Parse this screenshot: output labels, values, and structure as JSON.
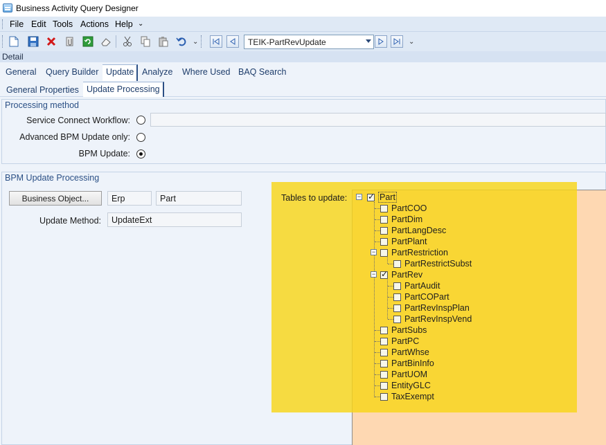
{
  "window": {
    "title": "Business Activity Query Designer"
  },
  "menu": [
    "File",
    "Edit",
    "Tools",
    "Actions",
    "Help"
  ],
  "toolbar": {
    "icons": [
      "new-icon",
      "save-icon",
      "delete-icon",
      "attach-icon",
      "refresh-icon",
      "clear-icon",
      "cut-icon",
      "copy-icon",
      "paste-icon",
      "undo-icon"
    ],
    "record_value": "TEIK-PartRevUpdate"
  },
  "detail": {
    "label": "Detail"
  },
  "tabs": [
    "General",
    "Query Builder",
    "Update",
    "Analyze",
    "Where Used",
    "BAQ Search"
  ],
  "subtabs": [
    "General Properties",
    "Update  Processing"
  ],
  "processing": {
    "title": "Processing method",
    "service_connect_label": "Service Connect Workflow:",
    "advanced_bpm_label": "Advanced BPM Update only:",
    "bpm_update_label": "BPM Update:",
    "selected": "BPM Update:",
    "workflow_value": ""
  },
  "bpm": {
    "title": "BPM Update Processing",
    "business_object_button": "Business Object...",
    "bo_system": "Erp",
    "bo_name": "Part",
    "update_method_label": "Update Method:",
    "update_method_value": "UpdateExt",
    "tables_label": "Tables to update:"
  },
  "tree": {
    "root": {
      "label": "Part",
      "checked": true
    },
    "nodes": [
      {
        "label": "PartCOO",
        "checked": false
      },
      {
        "label": "PartDim",
        "checked": false
      },
      {
        "label": "PartLangDesc",
        "checked": false
      },
      {
        "label": "PartPlant",
        "checked": false
      },
      {
        "label": "PartRestriction",
        "checked": false
      },
      {
        "label": "PartRestrictSubst",
        "checked": false
      },
      {
        "label": "PartRev",
        "checked": true
      },
      {
        "label": "PartAudit",
        "checked": false
      },
      {
        "label": "PartCOPart",
        "checked": false
      },
      {
        "label": "PartRevInspPlan",
        "checked": false
      },
      {
        "label": "PartRevInspVend",
        "checked": false
      },
      {
        "label": "PartSubs",
        "checked": false
      },
      {
        "label": "PartPC",
        "checked": false
      },
      {
        "label": "PartWhse",
        "checked": false
      },
      {
        "label": "PartBinInfo",
        "checked": false
      },
      {
        "label": "PartUOM",
        "checked": false
      },
      {
        "label": "EntityGLC",
        "checked": false
      },
      {
        "label": "TaxExempt",
        "checked": false
      }
    ]
  },
  "colors": {
    "highlight": "#f8d619",
    "panel": "#fed8b2",
    "accent": "#2b4e84"
  }
}
